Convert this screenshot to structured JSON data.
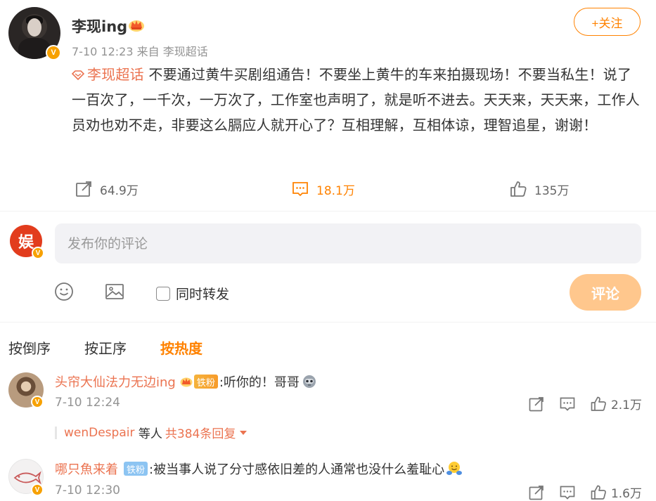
{
  "post": {
    "author": "李现ing",
    "time": "7-10 12:23",
    "source": "来自 李现超话",
    "follow_label": "+关注",
    "topic": "李现超话",
    "text": "不要通过黄牛买剧组通告！不要坐上黄牛的车来拍摄现场！不要当私生！说了一百次了，一千次，一万次了，工作室也声明了，就是听不进去。天天来，天天来，工作人员劝也劝不走，非要这么膈应人就开心了？互相理解，互相体谅，理智追星，谢谢！",
    "reposts": "64.9万",
    "comments": "18.1万",
    "likes": "135万"
  },
  "composer": {
    "avatar_text": "娱",
    "placeholder": "发布你的评论",
    "repost_label": "同时转发",
    "submit_label": "评论"
  },
  "sort_tabs": [
    {
      "label": "按倒序"
    },
    {
      "label": "按正序"
    },
    {
      "label": "按热度"
    }
  ],
  "comments": [
    {
      "name": "头帘大仙法力无边ing",
      "badge": "铁粉",
      "text": ":听你的！哥哥",
      "time": "7-10 12:24",
      "likes": "2.1万",
      "replies": {
        "users": "wenDespair",
        "suffix": "等人",
        "count": "共384条回复"
      }
    },
    {
      "name": "哪只魚来着",
      "badge": "铁粉",
      "text": ":被当事人说了分寸感依旧差的人通常也没什么羞耻心",
      "time": "7-10 12:30",
      "likes": "1.6万"
    }
  ],
  "colors": {
    "accent": "#ff8200",
    "link": "#eb7350",
    "verified": "#f7a100",
    "submit_disabled": "#ffc78d"
  },
  "icons": [
    "crown-icon",
    "topic-diamond-icon",
    "repost-icon",
    "comment-icon",
    "like-icon",
    "emoji-icon",
    "image-icon",
    "robot-emoji",
    "hug-emoji"
  ]
}
